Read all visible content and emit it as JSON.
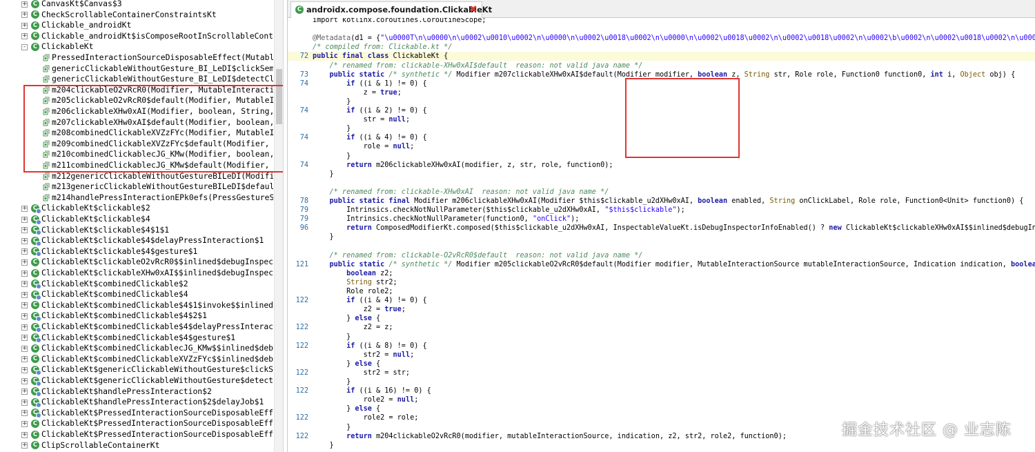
{
  "tree": {
    "items": [
      {
        "label": "CanvasKt$Canvas$3",
        "kind": "class",
        "indent": 1,
        "expander": "+"
      },
      {
        "label": "CheckScrollableContainerConstraintsKt",
        "kind": "class",
        "indent": 1,
        "expander": "+"
      },
      {
        "label": "Clickable_androidKt",
        "kind": "class",
        "indent": 1,
        "expander": "+"
      },
      {
        "label": "Clickable_androidKt$isComposeRootInScrollableContai",
        "kind": "class",
        "indent": 1,
        "expander": "+"
      },
      {
        "label": "ClickableKt",
        "kind": "class",
        "indent": 1,
        "expander": "-"
      },
      {
        "label": "PressedInteractionSourceDisposableEffect(MutableI",
        "kind": "method",
        "indent": 2
      },
      {
        "label": "genericClickableWithoutGesture_BI_LeDI$clickSemar",
        "kind": "method",
        "indent": 2
      },
      {
        "label": "genericClickableWithoutGesture_BI_LeDI$detectClic",
        "kind": "method",
        "indent": 2
      },
      {
        "label": "m204clickableO2vRcR0(Modifier, MutableInteraction",
        "kind": "method",
        "indent": 2
      },
      {
        "label": "m205clickableO2vRcR0$default(Modifier, MutableInt",
        "kind": "method",
        "indent": 2
      },
      {
        "label": "m206clickableXHw0xAI(Modifier, boolean, String, F",
        "kind": "method",
        "indent": 2
      },
      {
        "label": "m207clickableXHw0xAI$default(Modifier, boolean, S",
        "kind": "method",
        "indent": 2
      },
      {
        "label": "m208combinedClickableXVZzFYc(Modifier, MutableInt",
        "kind": "method",
        "indent": 2
      },
      {
        "label": "m209combinedClickableXVZzFYc$default(Modifier, Mu",
        "kind": "method",
        "indent": 2
      },
      {
        "label": "m210combinedClickablecJG_KMw(Modifier, boolean, S",
        "kind": "method",
        "indent": 2
      },
      {
        "label": "m211combinedClickablecJG_KMw$default(Modifier, bo",
        "kind": "method",
        "indent": 2
      },
      {
        "label": "m212genericClickableWithoutGestureBILeDI(Modifier",
        "kind": "method",
        "indent": 2
      },
      {
        "label": "m213genericClickableWithoutGestureBILeDI$default(",
        "kind": "method",
        "indent": 2
      },
      {
        "label": "m214handlePressInteractionEPk0efs(PressGestureSco",
        "kind": "method",
        "indent": 2
      },
      {
        "label": "ClickableKt$clickable$2",
        "kind": "inner",
        "indent": 1,
        "expander": "+"
      },
      {
        "label": "ClickableKt$clickable$4",
        "kind": "inner",
        "indent": 1,
        "expander": "+"
      },
      {
        "label": "ClickableKt$clickable$4$1$1",
        "kind": "inner",
        "indent": 1,
        "expander": "+"
      },
      {
        "label": "ClickableKt$clickable$4$delayPressInteraction$1",
        "kind": "inner",
        "indent": 1,
        "expander": "+"
      },
      {
        "label": "ClickableKt$clickable$4$gesture$1",
        "kind": "inner",
        "indent": 1,
        "expander": "+"
      },
      {
        "label": "ClickableKt$clickableO2vRcR0$$inlined$debugInspecto",
        "kind": "class",
        "indent": 1,
        "expander": "+"
      },
      {
        "label": "ClickableKt$clickableXHw0xAI$$inlined$debugInspecto",
        "kind": "class",
        "indent": 1,
        "expander": "+"
      },
      {
        "label": "ClickableKt$combinedClickable$2",
        "kind": "inner",
        "indent": 1,
        "expander": "+"
      },
      {
        "label": "ClickableKt$combinedClickable$4",
        "kind": "inner",
        "indent": 1,
        "expander": "+"
      },
      {
        "label": "ClickableKt$combinedClickable$4$1$invoke$$inlined$o",
        "kind": "class",
        "indent": 1,
        "expander": "+"
      },
      {
        "label": "ClickableKt$combinedClickable$4$2$1",
        "kind": "inner",
        "indent": 1,
        "expander": "+"
      },
      {
        "label": "ClickableKt$combinedClickable$4$delayPressInteracti",
        "kind": "inner",
        "indent": 1,
        "expander": "+"
      },
      {
        "label": "ClickableKt$combinedClickable$4$gesture$1",
        "kind": "inner",
        "indent": 1,
        "expander": "+"
      },
      {
        "label": "ClickableKt$combinedClickablecJG_KMw$$inlined$debug",
        "kind": "class",
        "indent": 1,
        "expander": "+"
      },
      {
        "label": "ClickableKt$combinedClickableXVZzFYc$$inlined$debug",
        "kind": "class",
        "indent": 1,
        "expander": "+"
      },
      {
        "label": "ClickableKt$genericClickableWithoutGesture$clickSem",
        "kind": "inner",
        "indent": 1,
        "expander": "+"
      },
      {
        "label": "ClickableKt$genericClickableWithoutGesture$detectCl",
        "kind": "inner",
        "indent": 1,
        "expander": "+"
      },
      {
        "label": "ClickableKt$handlePressInteraction$2",
        "kind": "inner",
        "indent": 1,
        "expander": "+"
      },
      {
        "label": "ClickableKt$handlePressInteraction$2$delayJob$1",
        "kind": "inner",
        "indent": 1,
        "expander": "+"
      },
      {
        "label": "ClickableKt$PressedInteractionSourceDisposableEffec",
        "kind": "inner",
        "indent": 1,
        "expander": "+"
      },
      {
        "label": "ClickableKt$PressedInteractionSourceDisposableEffec",
        "kind": "class",
        "indent": 1,
        "expander": "+"
      },
      {
        "label": "ClickableKt$PressedInteractionSourceDisposableEffec",
        "kind": "class",
        "indent": 1,
        "expander": "+"
      },
      {
        "label": "ClipScrollableContainerKt",
        "kind": "class",
        "indent": 1,
        "expander": "+"
      }
    ]
  },
  "editor": {
    "tab_title": "androidx.compose.foundation.ClickableKt",
    "tab_close": "✖",
    "lines": [
      {
        "num": "",
        "segs": [
          [
            "",
            "import kotlinx.coroutines.CoroutineScope;"
          ]
        ]
      },
      {
        "num": "",
        "segs": [
          [
            "",
            ""
          ]
        ]
      },
      {
        "num": "",
        "segs": [
          [
            "an",
            "@Metadata"
          ],
          [
            "",
            "(d1 = {"
          ],
          [
            "st",
            "\"\\u0000T\\n\\u0000\\n\\u0002\\u0010\\u0002\\n\\u0000\\n\\u0002\\u0018\\u0002\\n\\u0000\\n\\u0002\\u0018\\u0002\\n\\u0002\\u0018\\u0002\\n\\u0002\\b\\u0002\\n\\u0002\\u0018\\u0002\\n\\u0000\\n\\u0002"
          ]
        ]
      },
      {
        "num": "",
        "segs": [
          [
            "cm",
            "/* compiled from: Clickable.kt */"
          ]
        ]
      },
      {
        "num": "72",
        "hl": true,
        "segs": [
          [
            "kw",
            "public final class "
          ],
          [
            "",
            "ClickableKt {"
          ]
        ]
      },
      {
        "num": "",
        "segs": [
          [
            "cm",
            "    /* renamed from: clickable-XHw0xAI$default  reason: not valid java name */"
          ]
        ]
      },
      {
        "num": "73",
        "segs": [
          [
            "kw",
            "    public static "
          ],
          [
            "cm",
            "/* synthetic */ "
          ],
          [
            "",
            "Modifier m207clickableXHw0xAI$default(Modifier modifier, "
          ],
          [
            "kw",
            "boolean "
          ],
          [
            "",
            "z, "
          ],
          [
            "ty",
            "String "
          ],
          [
            "",
            "str, Role role, Function0 function0, "
          ],
          [
            "kw",
            "int "
          ],
          [
            "",
            "i, "
          ],
          [
            "ty",
            "Object "
          ],
          [
            "",
            "obj) {"
          ]
        ]
      },
      {
        "num": "74",
        "segs": [
          [
            "kw",
            "        if "
          ],
          [
            "",
            "((i & 1) != 0) {"
          ]
        ]
      },
      {
        "num": "",
        "segs": [
          [
            "",
            "            z = "
          ],
          [
            "kw",
            "true"
          ],
          [
            "",
            ";"
          ]
        ]
      },
      {
        "num": "",
        "segs": [
          [
            "",
            "        }"
          ]
        ]
      },
      {
        "num": "74",
        "segs": [
          [
            "kw",
            "        if "
          ],
          [
            "",
            "((i & 2) != 0) {"
          ]
        ]
      },
      {
        "num": "",
        "segs": [
          [
            "",
            "            str = "
          ],
          [
            "kw",
            "null"
          ],
          [
            "",
            ";"
          ]
        ]
      },
      {
        "num": "",
        "segs": [
          [
            "",
            "        }"
          ]
        ]
      },
      {
        "num": "74",
        "segs": [
          [
            "kw",
            "        if "
          ],
          [
            "",
            "((i & 4) != 0) {"
          ]
        ]
      },
      {
        "num": "",
        "segs": [
          [
            "",
            "            role = "
          ],
          [
            "kw",
            "null"
          ],
          [
            "",
            ";"
          ]
        ]
      },
      {
        "num": "",
        "segs": [
          [
            "",
            "        }"
          ]
        ]
      },
      {
        "num": "74",
        "segs": [
          [
            "kw",
            "        return "
          ],
          [
            "",
            "m206clickableXHw0xAI(modifier, z, str, role, function0);"
          ]
        ]
      },
      {
        "num": "",
        "segs": [
          [
            "",
            "    }"
          ]
        ]
      },
      {
        "num": "",
        "segs": [
          [
            "",
            ""
          ]
        ]
      },
      {
        "num": "",
        "segs": [
          [
            "cm",
            "    /* renamed from: clickable-XHw0xAI  reason: not valid java name */"
          ]
        ]
      },
      {
        "num": "78",
        "segs": [
          [
            "kw",
            "    public static final "
          ],
          [
            "",
            "Modifier m206clickableXHw0xAI(Modifier $this$clickable_u2dXHw0xAI, "
          ],
          [
            "kw",
            "boolean "
          ],
          [
            "",
            "enabled, "
          ],
          [
            "ty",
            "String "
          ],
          [
            "",
            "onClickLabel, Role role, Function0<Unit> function0) {"
          ]
        ]
      },
      {
        "num": "79",
        "segs": [
          [
            "",
            "        Intrinsics.checkNotNullParameter($this$clickable_u2dXHw0xAI, "
          ],
          [
            "st",
            "\"$this$clickable\""
          ],
          [
            "",
            ");"
          ]
        ]
      },
      {
        "num": "79",
        "segs": [
          [
            "",
            "        Intrinsics.checkNotNullParameter(function0, "
          ],
          [
            "st",
            "\"onClick\""
          ],
          [
            "",
            ");"
          ]
        ]
      },
      {
        "num": "96",
        "segs": [
          [
            "kw",
            "        return "
          ],
          [
            "",
            "ComposedModifierKt.composed($this$clickable_u2dXHw0xAI, InspectableValueKt.isDebugInspectorInfoEnabled() ? "
          ],
          [
            "kw",
            "new "
          ],
          [
            "",
            "ClickableKt$clickableXHw0xAI$$inlined$debugInspectorInfo"
          ]
        ]
      },
      {
        "num": "",
        "segs": [
          [
            "",
            "    }"
          ]
        ]
      },
      {
        "num": "",
        "segs": [
          [
            "",
            ""
          ]
        ]
      },
      {
        "num": "",
        "segs": [
          [
            "cm",
            "    /* renamed from: clickable-O2vRcR0$default  reason: not valid java name */"
          ]
        ]
      },
      {
        "num": "121",
        "segs": [
          [
            "kw",
            "    public static "
          ],
          [
            "cm",
            "/* synthetic */ "
          ],
          [
            "",
            "Modifier m205clickableO2vRcR0$default(Modifier modifier, MutableInteractionSource mutableInteractionSource, Indication indication, "
          ],
          [
            "kw",
            "boolean "
          ],
          [
            "",
            "z, "
          ],
          [
            "ty",
            "String"
          ]
        ]
      },
      {
        "num": "",
        "segs": [
          [
            "kw",
            "        boolean "
          ],
          [
            "",
            "z2;"
          ]
        ]
      },
      {
        "num": "",
        "segs": [
          [
            "ty",
            "        String "
          ],
          [
            "",
            "str2;"
          ]
        ]
      },
      {
        "num": "",
        "segs": [
          [
            "",
            "        Role role2;"
          ]
        ]
      },
      {
        "num": "122",
        "segs": [
          [
            "kw",
            "        if "
          ],
          [
            "",
            "((i & 4) != 0) {"
          ]
        ]
      },
      {
        "num": "",
        "segs": [
          [
            "",
            "            z2 = "
          ],
          [
            "kw",
            "true"
          ],
          [
            "",
            ";"
          ]
        ]
      },
      {
        "num": "",
        "segs": [
          [
            "",
            "        } "
          ],
          [
            "kw",
            "else "
          ],
          [
            "",
            "{"
          ]
        ]
      },
      {
        "num": "122",
        "segs": [
          [
            "",
            "            z2 = z;"
          ]
        ]
      },
      {
        "num": "",
        "segs": [
          [
            "",
            "        }"
          ]
        ]
      },
      {
        "num": "122",
        "segs": [
          [
            "kw",
            "        if "
          ],
          [
            "",
            "((i & 8) != 0) {"
          ]
        ]
      },
      {
        "num": "",
        "segs": [
          [
            "",
            "            str2 = "
          ],
          [
            "kw",
            "null"
          ],
          [
            "",
            ";"
          ]
        ]
      },
      {
        "num": "",
        "segs": [
          [
            "",
            "        } "
          ],
          [
            "kw",
            "else "
          ],
          [
            "",
            "{"
          ]
        ]
      },
      {
        "num": "122",
        "segs": [
          [
            "",
            "            str2 = str;"
          ]
        ]
      },
      {
        "num": "",
        "segs": [
          [
            "",
            "        }"
          ]
        ]
      },
      {
        "num": "122",
        "segs": [
          [
            "kw",
            "        if "
          ],
          [
            "",
            "((i & 16) != 0) {"
          ]
        ]
      },
      {
        "num": "",
        "segs": [
          [
            "",
            "            role2 = "
          ],
          [
            "kw",
            "null"
          ],
          [
            "",
            ";"
          ]
        ]
      },
      {
        "num": "",
        "segs": [
          [
            "",
            "        } "
          ],
          [
            "kw",
            "else "
          ],
          [
            "",
            "{"
          ]
        ]
      },
      {
        "num": "122",
        "segs": [
          [
            "",
            "            role2 = role;"
          ]
        ]
      },
      {
        "num": "",
        "segs": [
          [
            "",
            "        }"
          ]
        ]
      },
      {
        "num": "122",
        "segs": [
          [
            "kw",
            "        return "
          ],
          [
            "",
            "m204clickableO2vRcR0(modifier, mutableInteractionSource, indication, z2, str2, role2, function0);"
          ]
        ]
      },
      {
        "num": "",
        "segs": [
          [
            "",
            "    }"
          ]
        ]
      }
    ]
  },
  "watermark": "掘金技术社区 @ 业志陈",
  "colors": {
    "highlight_box": "#e03333",
    "class_icon": "#3f9a4c",
    "keyword": "#1a1aa6",
    "comment": "#4b8b5a",
    "line_number": "#2c6da3"
  }
}
